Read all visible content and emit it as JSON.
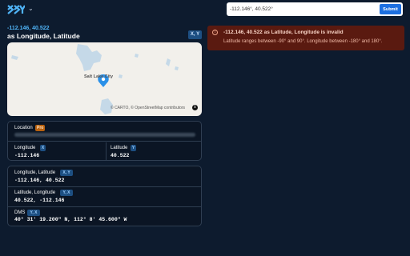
{
  "header": {
    "logo_icon": "xy-logo-icon",
    "menu_caret": "⌄",
    "search_value": "-112.146°, 40.522°",
    "search_placeholder": "",
    "submit_label": "Submit"
  },
  "result": {
    "coord_line": "-112.146, 40.522",
    "interpretation": "as Longitude, Latitude",
    "swap_label": "X, Y",
    "map_city": "Salt Lake City",
    "map_attribution": "© CARTO, © OpenStreetMap contributors",
    "map_info_label": "i"
  },
  "location_card": {
    "label": "Location",
    "pro_badge": "Pro",
    "longitude_label": "Longitude",
    "longitude_badge": "X",
    "longitude_value": "-112.146",
    "latitude_label": "Latitude",
    "latitude_badge": "Y",
    "latitude_value": "40.522"
  },
  "formats_card": {
    "lonlat_label": "Longitude, Latitude",
    "lonlat_badge": "X, Y",
    "lonlat_value": "-112.146, 40.522",
    "latlon_label": "Latitude, Longitude",
    "latlon_badge": "Y, X",
    "latlon_value": "40.522, -112.146",
    "dms_label": "DMS",
    "dms_badge": "Y, X",
    "dms_value": "40° 31' 19.200\" N, 112° 8' 45.600\" W"
  },
  "error": {
    "icon": "warning-icon",
    "title": "-112.146, 40.522 as Latitude, Longitude is invalid",
    "description": "Latitude ranges between -90° and 90°. Longitude between -180° and 180°."
  },
  "colors": {
    "background": "#0d1b2e",
    "accent": "#4fb3f6",
    "submit": "#1c6fe0",
    "error_bg": "#5a1a10",
    "pro": "#b8610f",
    "pin": "#2a90e8"
  }
}
